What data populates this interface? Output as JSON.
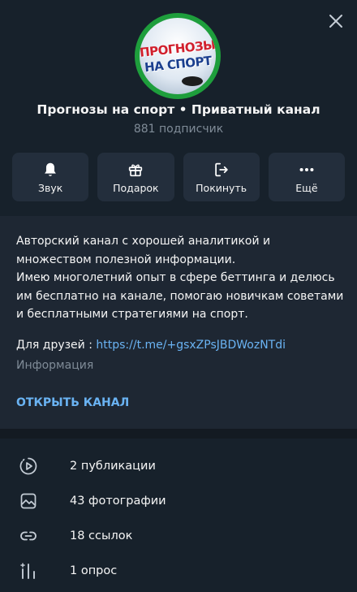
{
  "channel": {
    "title": "Прогнозы на спорт • Приватный канал",
    "subscribers": "881 подписчик",
    "logo_line1": "ПРОГНОЗЫ",
    "logo_line2": "НА СПОРТ"
  },
  "actions": {
    "sound": "Звук",
    "gift": "Подарок",
    "leave": "Покинуть",
    "more": "Ещё"
  },
  "description": {
    "text": "Авторский канал с хорошей аналитикой и\nмножеством полезной информации.\nИмею многолетний опыт в сфере беттинга и делюсь\nим бесплатно на канале, помогаю новичкам советами\nи бесплатными стратегиями на спорт.",
    "friends_prefix": "Для друзей : ",
    "friends_link": "https://t.me/+gsxZPsJBDWozNTdi",
    "info_label": "Информация",
    "open_channel": "ОТКРЫТЬ КАНАЛ"
  },
  "media": {
    "posts": "2 публикации",
    "photos": "43 фотографии",
    "links": "18 ссылок",
    "polls": "1 опрос"
  },
  "colors": {
    "background": "#17212b",
    "card": "#232e3c",
    "section": "#1e2733",
    "accent": "#6ab3f3",
    "muted": "#7f8b97",
    "avatar_ring": "#1e9e3c"
  },
  "icons": [
    "close-icon",
    "bell-icon",
    "gift-icon",
    "leave-icon",
    "more-icon",
    "posts-icon",
    "photo-icon",
    "link-icon",
    "poll-icon"
  ]
}
